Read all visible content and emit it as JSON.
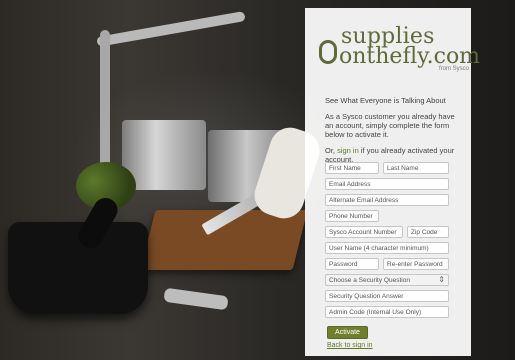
{
  "brand": {
    "line1": "supplies",
    "line2": "onthefly.com",
    "sub": "from Sysco"
  },
  "intro": {
    "heading": "See What Everyone is Talking About",
    "p1": "As a Sysco customer you already have an account, simply complete the form below to activate it.",
    "p2_prefix": "Or, ",
    "p2_link": "sign in",
    "p2_suffix": " if you already activated your account."
  },
  "form": {
    "first_name": "First Name",
    "last_name": "Last Name",
    "email": "Email Address",
    "alt_email": "Alternate Email Address",
    "phone": "Phone Number",
    "sysco_account": "Sysco Account Number",
    "zip": "Zip Code",
    "username": "User Name (4 character minimum)",
    "password": "Password",
    "reenter": "Re-enter Password",
    "security_question": "Choose a Security Question",
    "security_answer": "Security Question Answer",
    "admin_code": "Admin Code (Internal Use Only)",
    "activate": "Activate",
    "back": "Back to sign in"
  },
  "colors": {
    "brand_green": "#5f6a3a",
    "button_green": "#6f7f2f",
    "link_green": "#607a2b"
  },
  "icons": {
    "select_arrow": "up-down-arrows-icon"
  }
}
